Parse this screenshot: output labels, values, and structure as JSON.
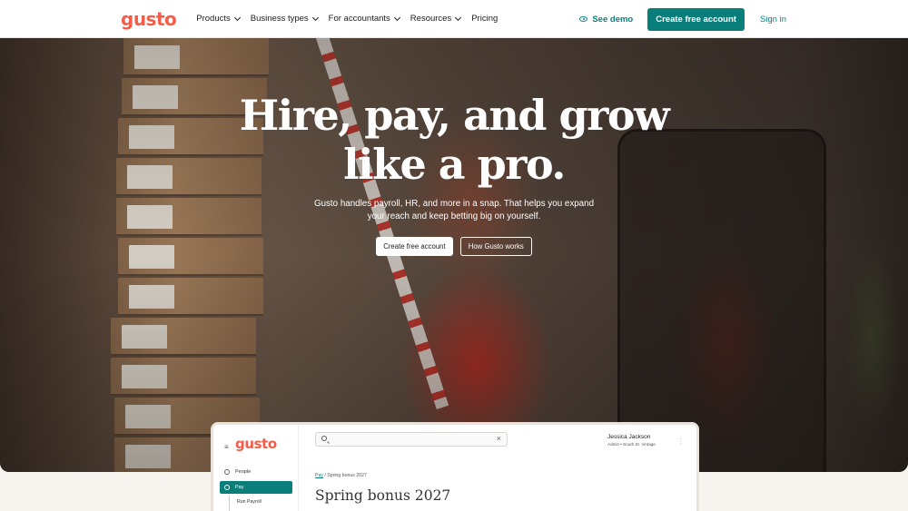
{
  "nav": {
    "logo": "gusto",
    "links": [
      "Products",
      "Business types",
      "For accountants",
      "Resources",
      "Pricing"
    ],
    "see_demo": "See demo",
    "create_account": "Create free account",
    "sign_in": "Sign in"
  },
  "hero": {
    "title_line1": "Hire, pay, and grow",
    "title_line2": "like a pro.",
    "subtitle": "Gusto handles payroll, HR, and more in a snap. That helps you expand your reach and keep betting big on yourself.",
    "primary_cta": "Create free account",
    "secondary_cta": "How Gusto works"
  },
  "app_preview": {
    "logo": "gusto",
    "sidebar": [
      {
        "label": "People",
        "active": false
      },
      {
        "label": "Pay",
        "active": true
      }
    ],
    "sub_item": "Run Payroll",
    "search_clear": "×",
    "user_name": "Jessica Jackson",
    "user_meta": "Admin • South St. Vintage",
    "breadcrumb_link": "Pay",
    "breadcrumb_rest": "/ Spring bonus 2027",
    "page_title": "Spring bonus 2027"
  },
  "colors": {
    "brand": "#f45d48",
    "accent": "#0a7e7a"
  }
}
